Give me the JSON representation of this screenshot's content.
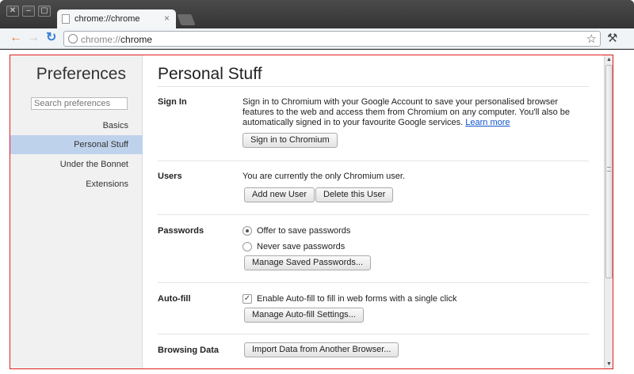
{
  "window": {
    "close_glyph": "✕",
    "minimize_glyph": "–",
    "maximize_glyph": "▢"
  },
  "tab": {
    "title": "chrome://chrome",
    "close_glyph": "×"
  },
  "toolbar": {
    "back_icon": "back-arrow-icon",
    "forward_icon": "forward-arrow-icon",
    "reload_icon": "reload-icon",
    "url_scheme": "chrome://",
    "url_host": "chrome",
    "star_glyph": "☆",
    "wrench_glyph": "🔧"
  },
  "sidebar": {
    "title": "Preferences",
    "search_placeholder": "Search preferences",
    "items": [
      {
        "label": "Basics"
      },
      {
        "label": "Personal Stuff",
        "active": true
      },
      {
        "label": "Under the Bonnet"
      },
      {
        "label": "Extensions"
      }
    ]
  },
  "main": {
    "title": "Personal Stuff",
    "sign_in": {
      "label": "Sign In",
      "text": "Sign in to Chromium with your Google Account to save your personalised browser features to the web and access them from Chromium on any computer. You'll also be automatically signed in to your favourite Google services.",
      "link": "Learn more",
      "button": "Sign in to Chromium"
    },
    "users": {
      "label": "Users",
      "text": "You are currently the only Chromium user.",
      "add_button": "Add new User",
      "delete_button": "Delete this User"
    },
    "passwords": {
      "label": "Passwords",
      "option_offer": "Offer to save passwords",
      "option_never": "Never save passwords",
      "selected": "Offer to save passwords",
      "manage_button": "Manage Saved Passwords..."
    },
    "autofill": {
      "label": "Auto-fill",
      "checkbox_label": "Enable Auto-fill to fill in web forms with a single click",
      "checked": true,
      "manage_button": "Manage Auto-fill Settings..."
    },
    "browsing_data": {
      "label": "Browsing Data",
      "import_button": "Import Data from Another Browser..."
    }
  },
  "colors": {
    "frame_border": "#e02020",
    "sidebar_active": "#bfd2ec",
    "link": "#1155cc",
    "reload": "#3b7fd4",
    "nav_arrow": "#e87d2a"
  }
}
